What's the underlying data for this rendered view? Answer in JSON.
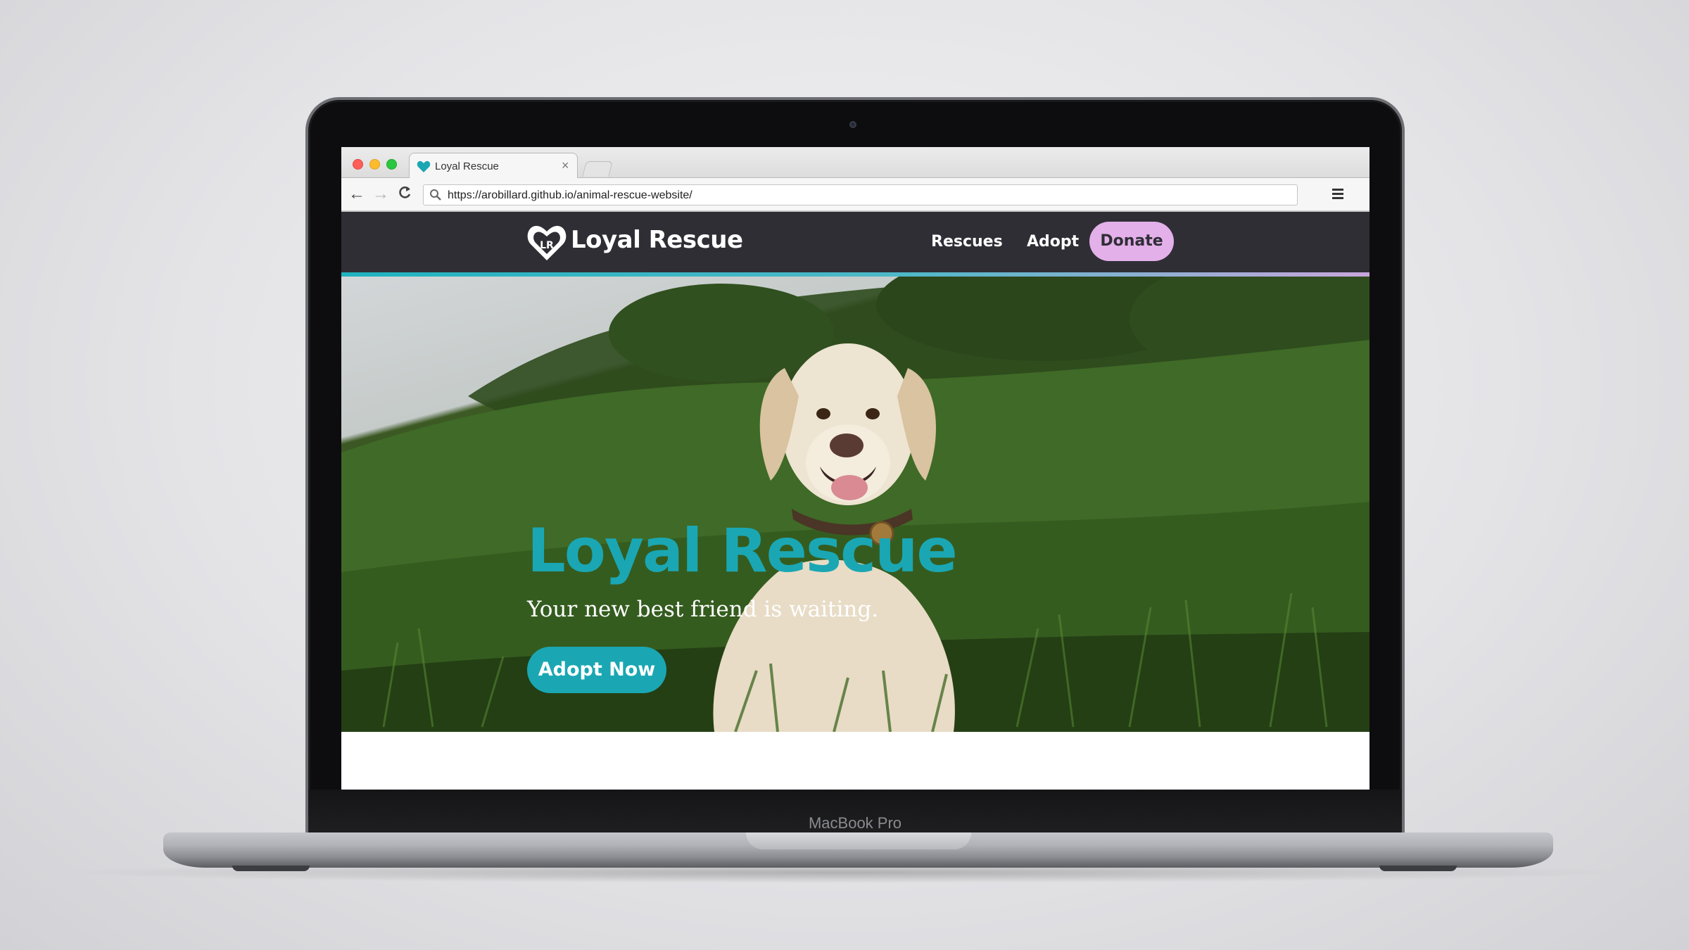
{
  "device": {
    "model_label": "MacBook Pro"
  },
  "browser": {
    "tab": {
      "title": "Loyal Rescue",
      "close_glyph": "×"
    },
    "toolbar": {
      "back_glyph": "←",
      "forward_glyph": "→",
      "reload_glyph": "C",
      "address": "https://arobillard.github.io/animal-rescue-website/"
    }
  },
  "site": {
    "brand": {
      "logo_initials": "LR",
      "name": "Loyal Rescue"
    },
    "nav": {
      "rescues": "Rescues",
      "adopt": "Adopt",
      "donate": "Donate"
    },
    "hero": {
      "title": "Loyal Rescue",
      "subtitle": "Your new best friend is waiting.",
      "cta": "Adopt Now"
    }
  },
  "colors": {
    "header_bg": "#2f2e35",
    "accent_teal": "#1aa7b3",
    "accent_pink": "#e3b0ea"
  }
}
